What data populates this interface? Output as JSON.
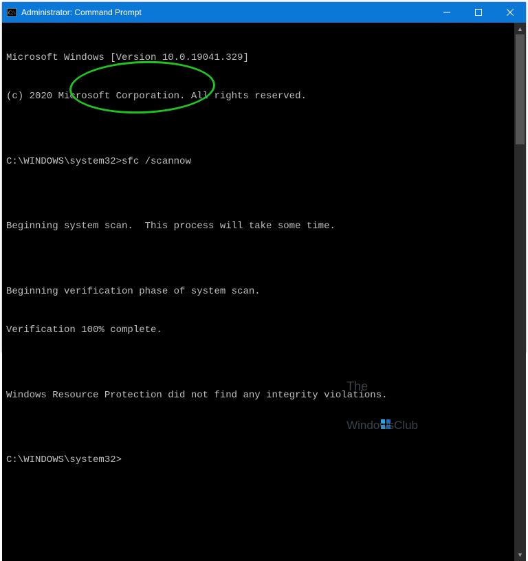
{
  "window": {
    "title": "Administrator: Command Prompt"
  },
  "console": {
    "lines": [
      "Microsoft Windows [Version 10.0.19041.329]",
      "(c) 2020 Microsoft Corporation. All rights reserved.",
      "",
      "C:\\WINDOWS\\system32>sfc /scannow",
      "",
      "Beginning system scan.  This process will take some time.",
      "",
      "Beginning verification phase of system scan.",
      "Verification 100% complete.",
      "",
      "Windows Resource Protection did not find any integrity violations.",
      "",
      "C:\\WINDOWS\\system32>"
    ]
  },
  "annotation": {
    "highlighted_command": "sfc /scannow"
  },
  "watermark": {
    "line1": "The",
    "line2": "WindowsClub"
  }
}
